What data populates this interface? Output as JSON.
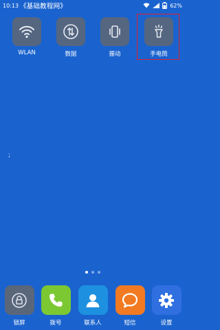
{
  "status_bar": {
    "time": "10:13",
    "title": "《基础教程网》",
    "battery": "62%"
  },
  "quick_toggles": [
    {
      "label": "WLAN",
      "icon": "wifi-icon"
    },
    {
      "label": "数据",
      "icon": "mobile-data-icon"
    },
    {
      "label": "振动",
      "icon": "vibrate-icon"
    },
    {
      "label": "手电筒",
      "icon": "flashlight-icon"
    }
  ],
  "stray_mark": ";",
  "page_indicator": {
    "count": 3,
    "active": 1
  },
  "dock": [
    {
      "label": "锁屏",
      "icon": "lock-icon",
      "color": "#5a667a"
    },
    {
      "label": "拨号",
      "icon": "phone-icon",
      "color": "#7cc832"
    },
    {
      "label": "联系人",
      "icon": "contact-icon",
      "color": "#1e90e0"
    },
    {
      "label": "短信",
      "icon": "message-icon",
      "color": "#f27a22"
    },
    {
      "label": "设置",
      "icon": "gear-icon",
      "color": "#2f6fe0"
    }
  ],
  "colors": {
    "wallpaper": "#1a63cf",
    "highlight": "#e0202a"
  }
}
